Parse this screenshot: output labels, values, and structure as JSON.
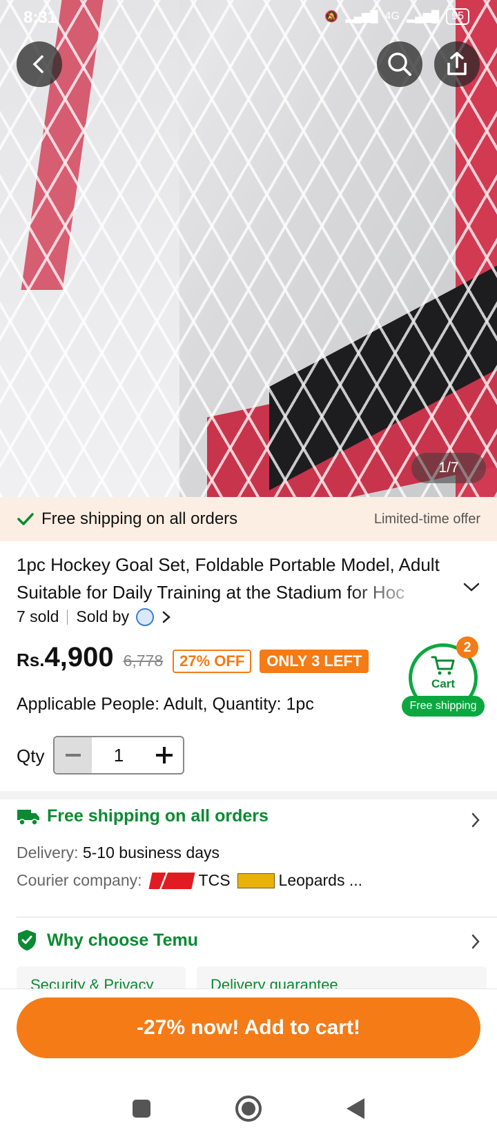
{
  "status_bar": {
    "time": "8:31",
    "network": "4G",
    "battery": "95"
  },
  "gallery": {
    "counter": "1/7"
  },
  "shipping_banner": {
    "text": "Free shipping on all orders",
    "offer": "Limited-time offer"
  },
  "product": {
    "title_line1": "1pc Hockey Goal Set, Foldable Portable Model, Adult",
    "title_line2": "Suitable for Daily Training at the Stadium for Hoc",
    "sold": "7 sold",
    "sold_by": "Sold by",
    "currency": "Rs.",
    "price": "4,900",
    "original_price": "6,778",
    "discount_badge": "27% OFF",
    "stock_badge": "ONLY 3 LEFT",
    "applicable": "Applicable People: Adult, Quantity: 1pc",
    "qty_label": "Qty",
    "qty_value": "1"
  },
  "cart": {
    "label": "Cart",
    "count": "2",
    "free_shipping": "Free shipping"
  },
  "shipping_section": {
    "title": "Free shipping on all orders",
    "delivery_label": "Delivery:",
    "delivery_value": "5-10 business days",
    "courier_label": "Courier company:",
    "courier1": "TCS",
    "courier2": "Leopards ..."
  },
  "why": {
    "title": "Why choose Temu",
    "card1": "Security & Privacy",
    "card2": "Delivery guarantee"
  },
  "cta": {
    "label": "-27% now! Add to cart!"
  },
  "colors": {
    "accent": "#f47b16",
    "green": "#0aa83f",
    "banner_bg": "#fdeee3"
  }
}
